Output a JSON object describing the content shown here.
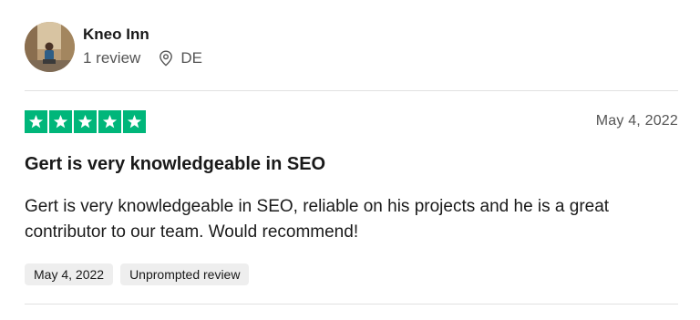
{
  "reviewer": {
    "name": "Kneo Inn",
    "review_count": "1 review",
    "location_icon": "location-pin-icon",
    "country": "DE"
  },
  "review": {
    "rating": 5,
    "rating_max": 5,
    "star_icon": "star-icon",
    "star_color": "#00b67a",
    "date": "May 4, 2022",
    "title": "Gert is very knowledgeable in SEO",
    "body": "Gert is very knowledgeable in SEO, reliable on his projects and he is a great contributor to our team. Would recommend!",
    "tags": [
      {
        "label": "May 4, 2022"
      },
      {
        "label": "Unprompted review"
      }
    ]
  }
}
